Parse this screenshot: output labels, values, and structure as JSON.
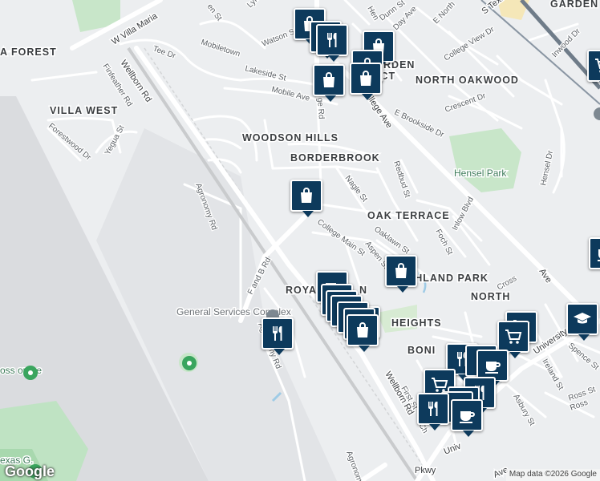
{
  "neighborhoods": [
    "WOODSON HILLS",
    "BORDERBROOK",
    "OAK TERRACE",
    "VILLA WEST",
    "NORTH OAKWOOD",
    "ARDEN",
    "RICT",
    "HIGHLAND PARK",
    "ROYAL",
    "N",
    "HEIGHTS",
    "NORTH",
    "BONI",
    "GARDEN",
    "A FOREST"
  ],
  "streets": [
    "Wellborn Rd",
    "College Ave",
    "W Villa Maria",
    "Tee Dr",
    "Finfeather Rd",
    "Forestwood Dr",
    "Yegua St",
    "Mobiletown",
    "Lakeside St",
    "Mobile Ave",
    "Watson St",
    "Agronomy Rd",
    "F and B Rd",
    "Agronomy Rd",
    "College Main St",
    "Nagle St",
    "Redbud St",
    "Oaklawn St",
    "Aspen St",
    "Foch St",
    "Inlow Blvd",
    "Hensel Dr",
    "Cross",
    "University Dr",
    "Spence St",
    "Ireland St",
    "Asbury St",
    "Ross St",
    "Univ",
    "First St",
    "Ch",
    "Dunn St",
    "Day Ave",
    "E North",
    "S Texas Ave",
    "College View Dr",
    "E Brookside Dr",
    "Crescent Dr",
    "Inwood Dr",
    "Ave",
    "Ross",
    "Wellborn Rd",
    "Agronom",
    "Pkwy",
    "Ave",
    "ge Rd",
    "en St",
    "Lyn",
    "Hen"
  ],
  "pois": {
    "general_services": "General Services Complex",
    "hensel_park": "Hensel Park",
    "texas": "exas G.",
    "ross_course": "oss ourse"
  },
  "pins": [
    {
      "icon": "shopping-bag"
    },
    {
      "icon": "shopping-bag"
    },
    {
      "icon": "restaurant"
    },
    {
      "icon": "shopping-bag"
    },
    {
      "icon": "shopping-bag"
    },
    {
      "icon": "shopping-bag"
    },
    {
      "icon": "shopping-bag"
    },
    {
      "icon": "shopping-cart"
    },
    {
      "icon": "shopping-bag"
    },
    {
      "icon": "shopping-bag"
    },
    {
      "icon": "coffee"
    },
    {
      "icon": "shopping-bag"
    },
    {
      "icon": "coffee"
    },
    {
      "icon": "restaurant"
    },
    {
      "icon": "restaurant"
    },
    {
      "icon": "restaurant"
    },
    {
      "icon": "restaurant"
    },
    {
      "icon": "shopping-bag"
    },
    {
      "icon": "restaurant"
    },
    {
      "icon": "shopping-cart"
    },
    {
      "icon": "shopping-cart"
    },
    {
      "icon": "graduation-cap"
    },
    {
      "icon": "restaurant"
    },
    {
      "icon": "restaurant"
    },
    {
      "icon": "coffee"
    },
    {
      "icon": "shopping-cart"
    },
    {
      "icon": "restaurant"
    },
    {
      "icon": "restaurant"
    },
    {
      "icon": "restaurant"
    },
    {
      "icon": "restaurant"
    },
    {
      "icon": "coffee"
    },
    {
      "icon": "coffee"
    }
  ],
  "branding": {
    "logo": "Google",
    "attribution": "Map data ©2026 Google"
  }
}
